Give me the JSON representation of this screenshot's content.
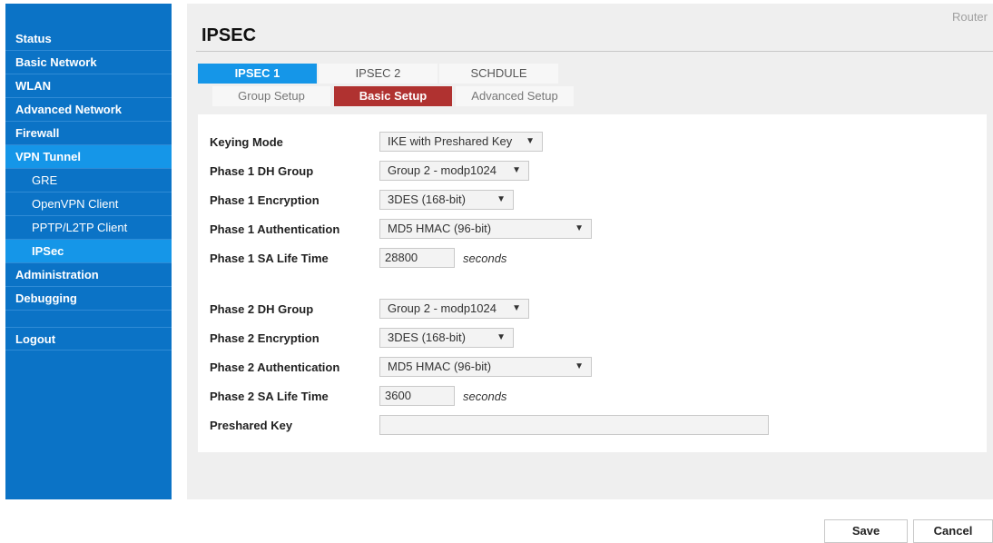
{
  "sidebar": {
    "items": [
      {
        "label": "Status"
      },
      {
        "label": "Basic Network"
      },
      {
        "label": "WLAN"
      },
      {
        "label": "Advanced Network"
      },
      {
        "label": "Firewall"
      },
      {
        "label": "VPN Tunnel"
      },
      {
        "label": "GRE"
      },
      {
        "label": "OpenVPN Client"
      },
      {
        "label": "PPTP/L2TP Client"
      },
      {
        "label": "IPSec"
      },
      {
        "label": "Administration"
      },
      {
        "label": "Debugging"
      },
      {
        "label": "Logout"
      }
    ]
  },
  "header": {
    "router_label": "Router",
    "title": "IPSEC"
  },
  "tabs_primary": [
    {
      "label": "IPSEC 1"
    },
    {
      "label": "IPSEC 2"
    },
    {
      "label": "SCHDULE"
    }
  ],
  "tabs_secondary": [
    {
      "label": "Group Setup"
    },
    {
      "label": "Basic Setup"
    },
    {
      "label": "Advanced Setup"
    }
  ],
  "form": {
    "keying_mode": {
      "label": "Keying Mode",
      "value": "IKE with Preshared Key"
    },
    "p1_dh": {
      "label": "Phase 1 DH Group",
      "value": "Group 2 - modp1024"
    },
    "p1_enc": {
      "label": "Phase 1 Encryption",
      "value": "3DES (168-bit)"
    },
    "p1_auth": {
      "label": "Phase 1 Authentication",
      "value": "MD5 HMAC (96-bit)"
    },
    "p1_life": {
      "label": "Phase 1 SA Life Time",
      "value": "28800",
      "units": "seconds"
    },
    "p2_dh": {
      "label": "Phase 2 DH Group",
      "value": "Group 2 - modp1024"
    },
    "p2_enc": {
      "label": "Phase 2 Encryption",
      "value": "3DES (168-bit)"
    },
    "p2_auth": {
      "label": "Phase 2 Authentication",
      "value": "MD5 HMAC (96-bit)"
    },
    "p2_life": {
      "label": "Phase 2 SA Life Time",
      "value": "3600",
      "units": "seconds"
    },
    "psk": {
      "label": "Preshared Key",
      "value": ""
    }
  },
  "actions": {
    "save": "Save",
    "cancel": "Cancel"
  },
  "icons": {
    "dropdown": "chevron-down-icon"
  },
  "colors": {
    "sidebar": "#0b73c6",
    "active_tab": "#1596e8",
    "active_subtab": "#b03230"
  }
}
